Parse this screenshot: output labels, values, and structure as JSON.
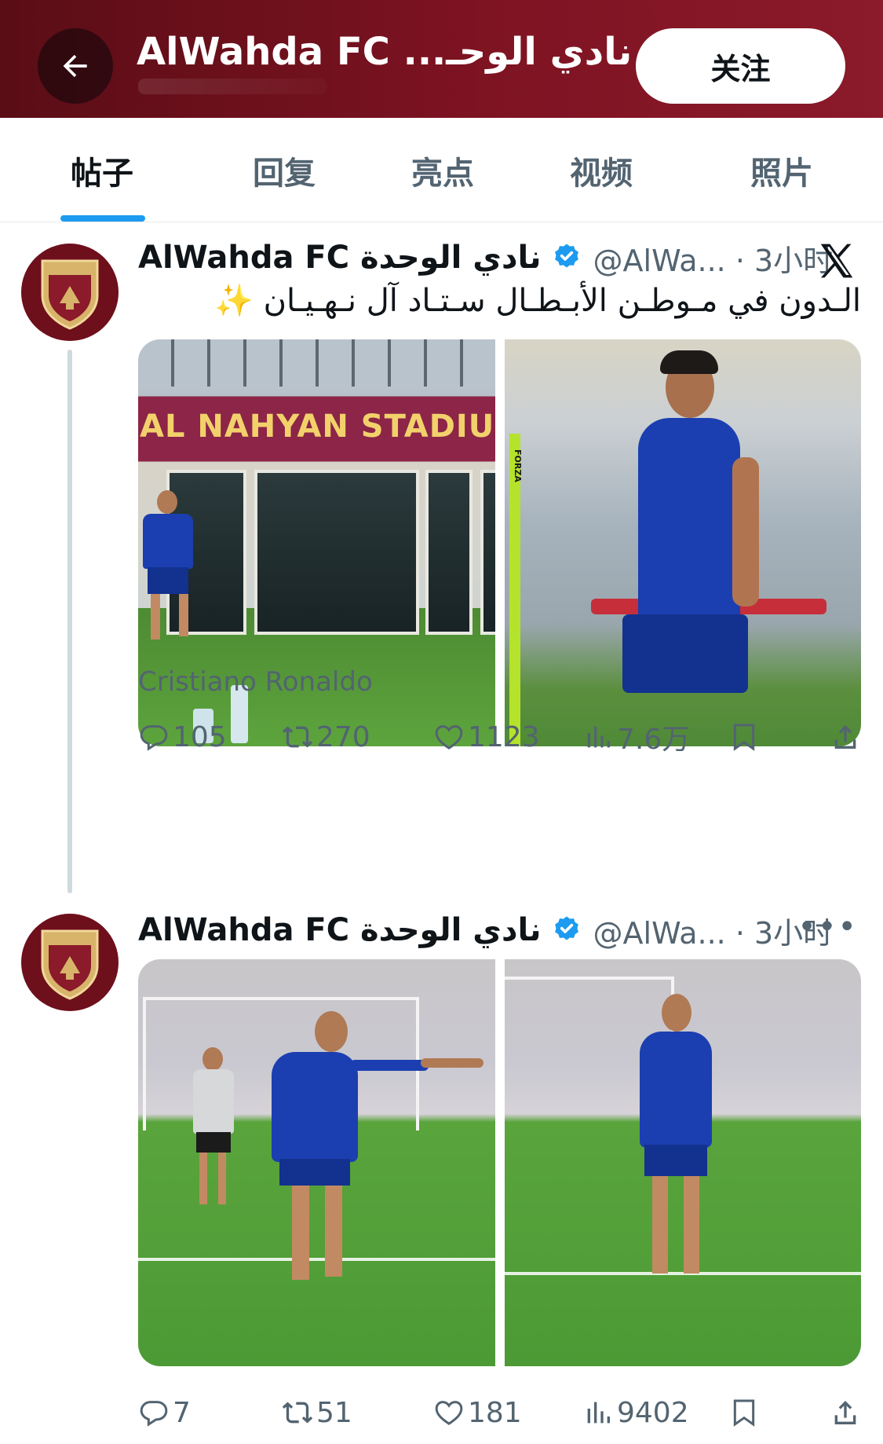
{
  "header": {
    "back_icon": "arrow-left-icon",
    "title": "AlWahda FC ...نادي الوحـ",
    "follow_label": "关注",
    "colors": {
      "bg_start": "#5a0d16",
      "bg_end": "#8b1a2a"
    }
  },
  "tabs": [
    {
      "label": "帖子",
      "active": true
    },
    {
      "label": "回复",
      "active": false
    },
    {
      "label": "亮点",
      "active": false
    },
    {
      "label": "视频",
      "active": false
    },
    {
      "label": "照片",
      "active": false
    }
  ],
  "accent_color": "#1d9bf0",
  "posts": [
    {
      "display_name": "AlWahda FC نادي الوحدة",
      "handle": "@AlWa... · 3小时",
      "text": "الـدون في مـوطـن الأبـطـال سـتـاد آل نـهـيـان ✨",
      "images": [
        {
          "banner": "AL NAHYAN STADIUM"
        },
        {
          "pole_text": "FORZA"
        }
      ],
      "caption": "Cristiano Ronaldo",
      "stats": {
        "replies": "105",
        "reposts": "270",
        "likes": "1123",
        "views": "7.6万"
      }
    },
    {
      "display_name": "AlWahda FC نادي الوحدة",
      "handle": "@AlWa... · 3小时",
      "stats": {
        "replies": "7",
        "reposts": "51",
        "likes": "181",
        "views": "9402"
      }
    }
  ]
}
